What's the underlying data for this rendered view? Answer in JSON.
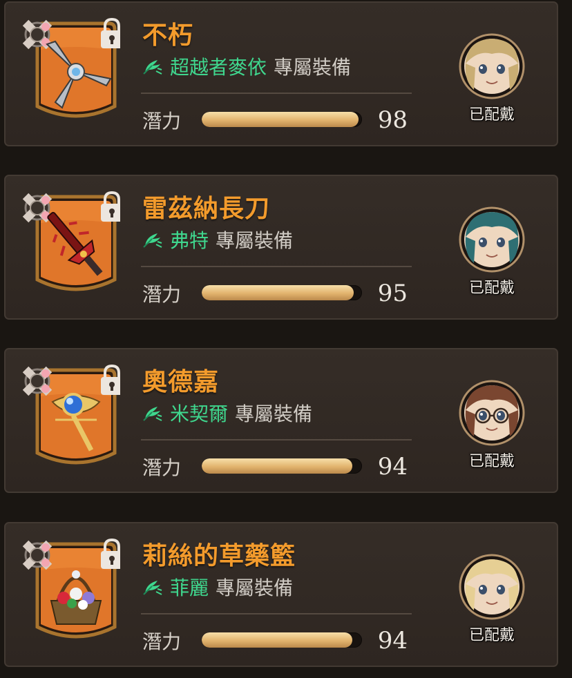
{
  "equipment_list": {
    "potential_label": "潛力",
    "equipped_label": "已配戴",
    "items": [
      {
        "name": "不朽",
        "owner": "超越者麥依",
        "owner_suffix": "專屬裝備",
        "potential": 98,
        "potential_max": 100,
        "weapon_icon": "shuriken-icon",
        "portrait": "blonde-hero-portrait",
        "hair_color": "#c9ad73"
      },
      {
        "name": "雷茲納長刀",
        "owner": "弗特",
        "owner_suffix": "專屬裝備",
        "potential": 95,
        "potential_max": 100,
        "weapon_icon": "crimson-blade-icon",
        "portrait": "teal-hair-portrait",
        "hair_color": "#2e6f73"
      },
      {
        "name": "奧德嘉",
        "owner": "米契爾",
        "owner_suffix": "專屬裝備",
        "potential": 94,
        "potential_max": 100,
        "weapon_icon": "blue-orb-staff-icon",
        "portrait": "glasses-portrait",
        "hair_color": "#7a4630"
      },
      {
        "name": "莉絲的草藥籃",
        "owner": "菲麗",
        "owner_suffix": "專屬裝備",
        "potential": 94,
        "potential_max": 100,
        "weapon_icon": "flower-basket-icon",
        "portrait": "blonde-girl-portrait",
        "hair_color": "#e6cf94"
      }
    ]
  },
  "colors": {
    "name_orange": "#f39b2c",
    "owner_green": "#3fd78e",
    "bar_gold": "#e2b36d",
    "frame_orange": "#e0762a"
  }
}
